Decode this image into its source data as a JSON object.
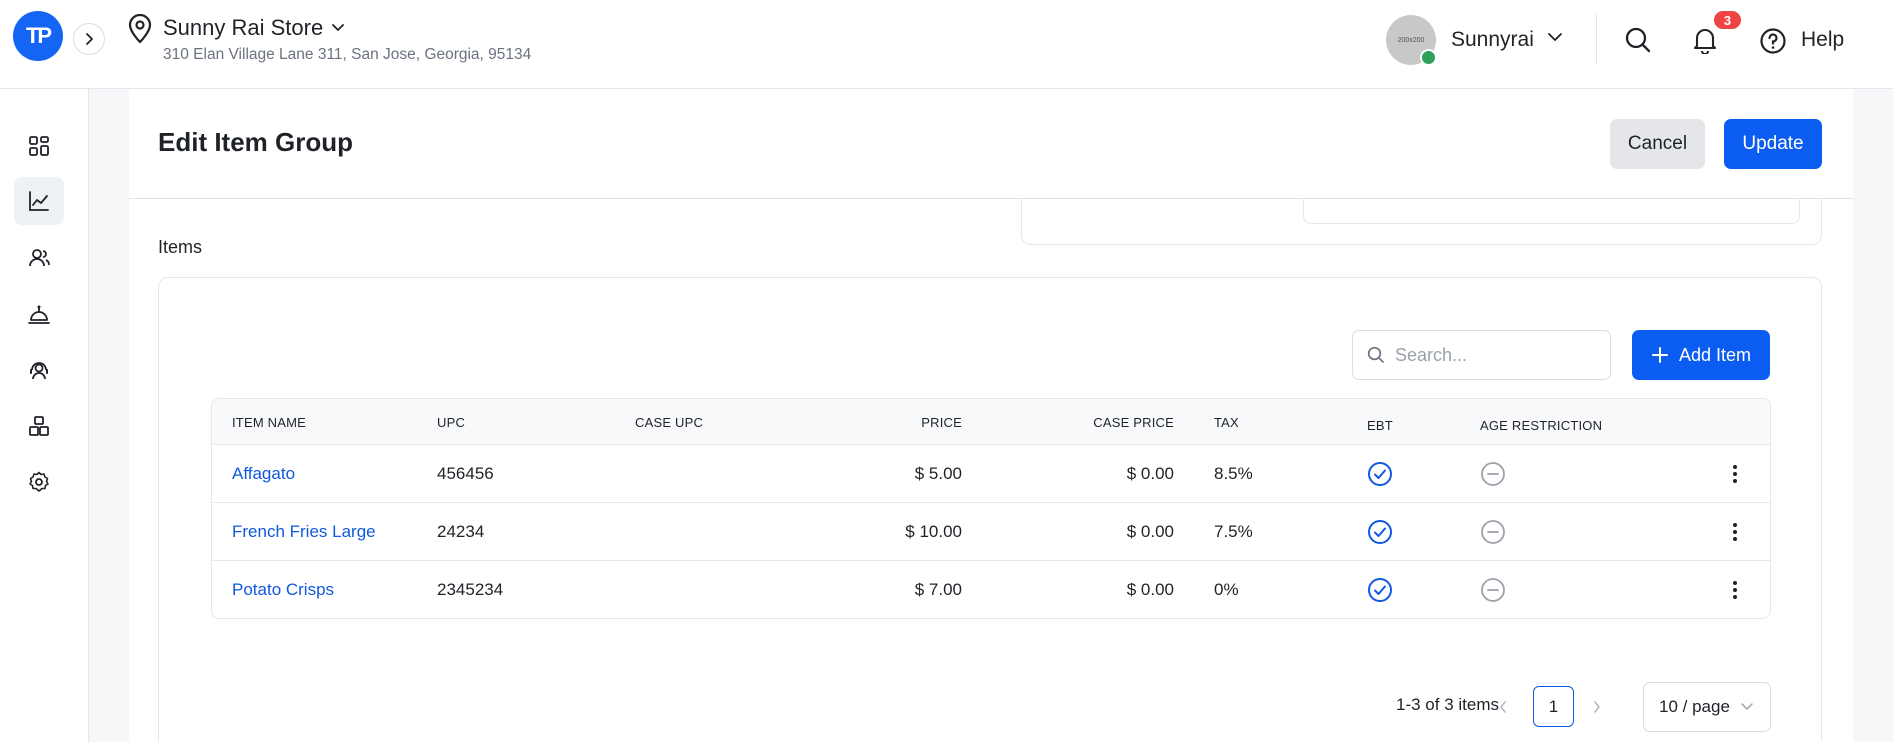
{
  "header": {
    "logo_text": "TP",
    "store_name": "Sunny Rai Store",
    "store_address": "310 Elan Village Lane 311, San Jose, Georgia, 95134",
    "user_name": "Sunnyrai",
    "avatar_text": "200x200",
    "notification_count": "3",
    "help_label": "Help"
  },
  "sidebar": {
    "items": [
      {
        "icon": "dashboard-icon",
        "active": false
      },
      {
        "icon": "chart-icon",
        "active": true
      },
      {
        "icon": "users-icon",
        "active": false
      },
      {
        "icon": "service-bell-icon",
        "active": false
      },
      {
        "icon": "customer-support-icon",
        "active": false
      },
      {
        "icon": "boxes-icon",
        "active": false
      },
      {
        "icon": "gear-icon",
        "active": false
      }
    ]
  },
  "page": {
    "title": "Edit Item Group",
    "cancel_label": "Cancel",
    "update_label": "Update",
    "items_label": "Items"
  },
  "items_panel": {
    "search_placeholder": "Search...",
    "add_item_label": "Add Item",
    "columns": [
      "ITEM NAME",
      "UPC",
      "CASE UPC",
      "PRICE",
      "CASE PRICE",
      "TAX",
      "EBT",
      "AGE RESTRICTION"
    ],
    "rows": [
      {
        "name": "Affagato",
        "upc": "456456",
        "case_upc": "",
        "price": "$ 5.00",
        "case_price": "$ 0.00",
        "tax": "8.5%",
        "ebt": true,
        "age_restriction": false
      },
      {
        "name": "French Fries Large",
        "upc": "24234",
        "case_upc": "",
        "price": "$ 10.00",
        "case_price": "$ 0.00",
        "tax": "7.5%",
        "ebt": true,
        "age_restriction": false
      },
      {
        "name": "Potato Crisps",
        "upc": "2345234",
        "case_upc": "",
        "price": "$ 7.00",
        "case_price": "$ 0.00",
        "tax": "0%",
        "ebt": true,
        "age_restriction": false
      }
    ],
    "pagination": {
      "summary": "1-3 of 3 items",
      "current_page": "1",
      "page_size": "10 / page"
    }
  },
  "colors": {
    "brand_blue": "#0b5cf0",
    "link_blue": "#1059e0",
    "badge_red": "#ef4444",
    "online_green": "#2fa05a"
  }
}
